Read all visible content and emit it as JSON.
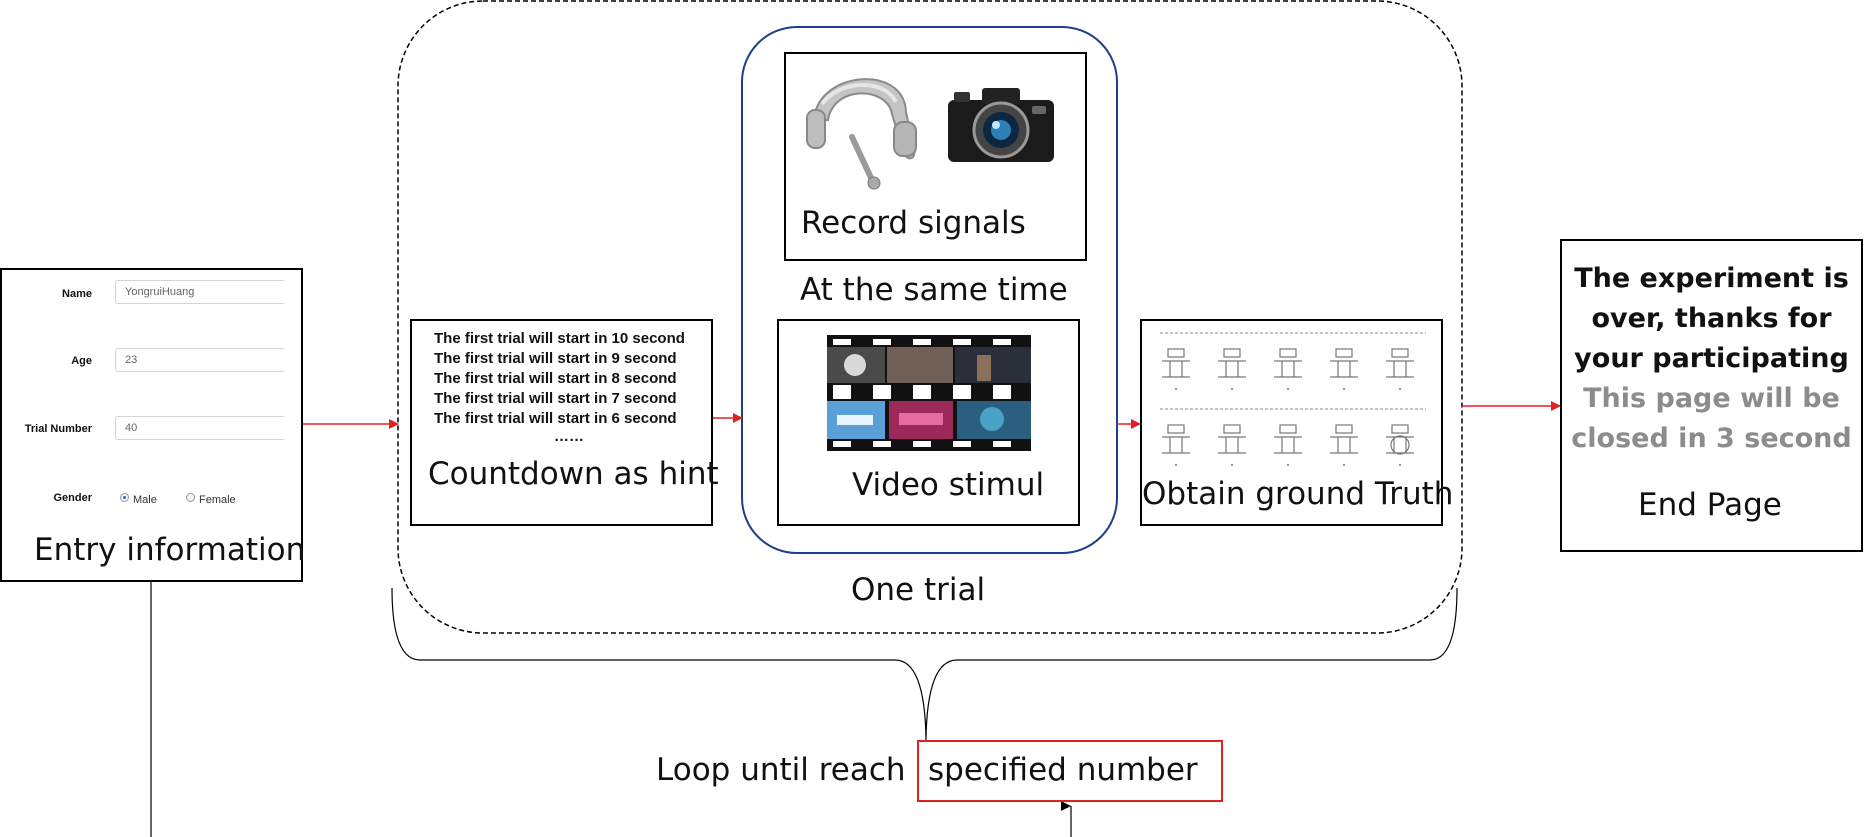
{
  "entry": {
    "fields": [
      {
        "label": "Name",
        "value": "YongruiHuang"
      },
      {
        "label": "Age",
        "value": "23"
      },
      {
        "label": "Trial Number",
        "value": "40"
      }
    ],
    "gender_label": "Gender",
    "gender_options": [
      "Male",
      "Female"
    ],
    "caption": "Entry information"
  },
  "countdown": {
    "lines": [
      "The first trial will start in 10 second",
      "The first trial will start in 9 second",
      "The first trial will start in 8 second",
      "The first trial will start in 7 second",
      "The first trial will start in 6 second"
    ],
    "ellipsis": "……",
    "caption": "Countdown as hint"
  },
  "record": {
    "caption": "Record signals",
    "icons": [
      "eeg-headset-icon",
      "camera-icon"
    ]
  },
  "same_time": "At the same time",
  "video": {
    "caption": "Video stimul"
  },
  "ground_truth": {
    "caption": "Obtain ground Truth"
  },
  "one_trial": "One trial",
  "end_page": {
    "line1": "The experiment is",
    "line2": "over, thanks for",
    "line3": "your participating",
    "line4": "This page will be",
    "line5": "closed in 3 second",
    "caption": "End Page"
  },
  "loop": {
    "prefix": "Loop until reach",
    "highlight": "specified number"
  },
  "colors": {
    "arrow_red": "#e32020",
    "trial_border": "#1f3e8c",
    "gray_text": "#8c8c8c",
    "highlight_border": "#e32020"
  }
}
